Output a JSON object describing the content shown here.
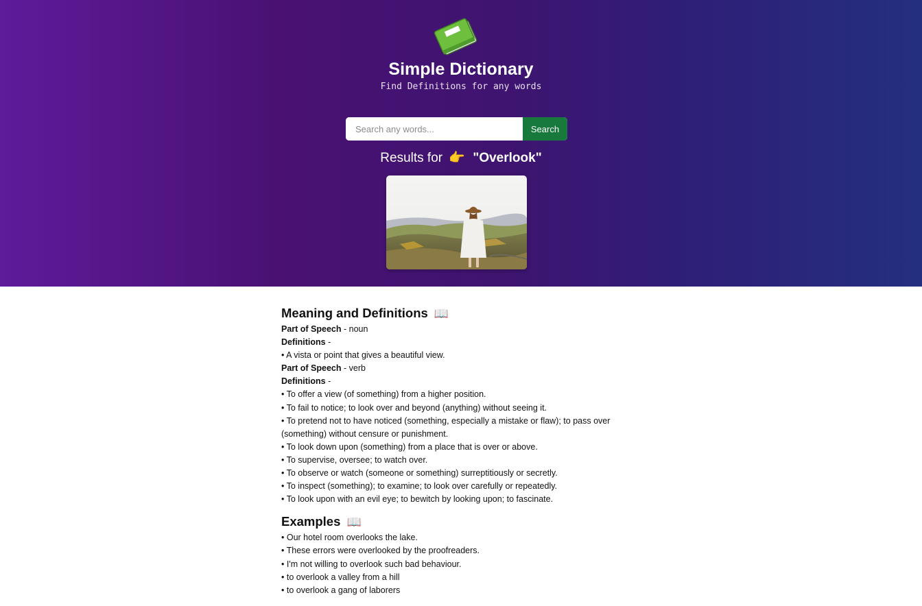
{
  "header": {
    "logo_icon": "green-book-icon",
    "title": "Simple Dictionary",
    "subtitle": "Find Definitions for any words"
  },
  "search": {
    "placeholder": "Search any words...",
    "value": "",
    "button_label": "Search"
  },
  "results": {
    "prefix": "Results for",
    "pointer_icon": "👉",
    "word": "\"Overlook\""
  },
  "meaning": {
    "title": "Meaning and Definitions",
    "title_icon": "📖",
    "groups": [
      {
        "pos_label": "Part of Speech",
        "pos_value": "- noun",
        "def_label": "Definitions",
        "def_suffix": "-",
        "definitions": [
          "• A vista or point that gives a beautiful view."
        ]
      },
      {
        "pos_label": "Part of Speech",
        "pos_value": "- verb",
        "def_label": "Definitions",
        "def_suffix": "-",
        "definitions": [
          "• To offer a view (of something) from a higher position.",
          "• To fail to notice; to look over and beyond (anything) without seeing it.",
          "• To pretend not to have noticed (something, especially a mistake or flaw); to pass over (something) without censure or punishment.",
          "• To look down upon (something) from a place that is over or above.",
          "• To supervise, oversee; to watch over.",
          "• To observe or watch (someone or something) surreptitiously or secretly.",
          "• To inspect (something); to examine; to look over carefully or repeatedly.",
          "• To look upon with an evil eye; to bewitch by looking upon; to fascinate."
        ]
      }
    ]
  },
  "examples": {
    "title": "Examples",
    "title_icon": "📖",
    "items": [
      "• Our hotel room overlooks the lake.",
      "• These errors were overlooked by the proofreaders.",
      "• I'm not willing to overlook such bad behaviour.",
      "• to overlook a valley from a hill",
      "• to overlook a gang of laborers"
    ]
  },
  "colors": {
    "search_button": "#177a3c",
    "gradient_left": "#5e1b9a",
    "gradient_right": "#24307f"
  }
}
